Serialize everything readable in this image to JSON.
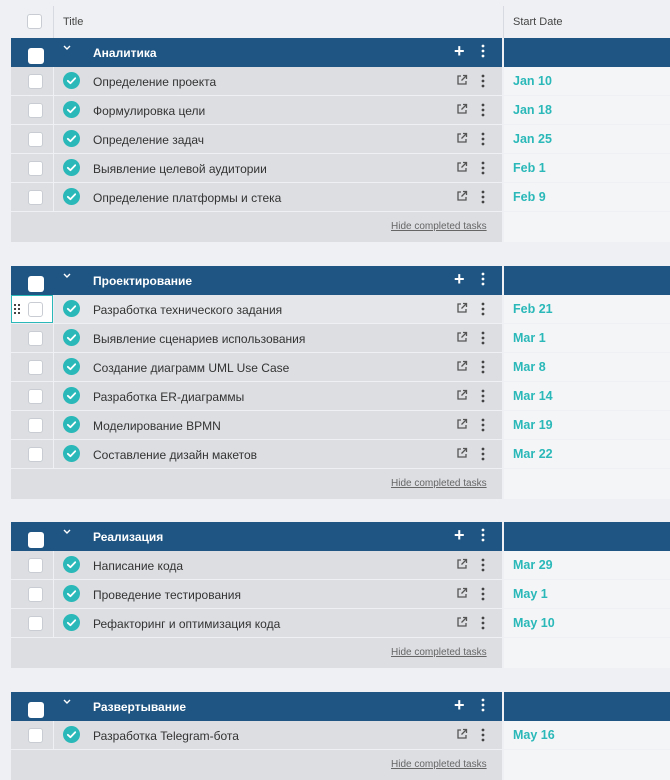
{
  "header": {
    "title_label": "Title",
    "date_label": "Start Date"
  },
  "colors": {
    "group_header": "#1f5582",
    "accent": "#2ab8b8",
    "row_bg": "#dcdee2"
  },
  "icons": {
    "group": [
      "chevron-down-icon",
      "plus-icon",
      "more-vertical-icon"
    ],
    "row": [
      "check-circle-icon",
      "external-link-icon",
      "more-vertical-icon"
    ]
  },
  "groups": [
    {
      "name": "Аналитика",
      "plus": "+",
      "footer_link": "Hide completed tasks",
      "tasks": [
        {
          "title": "Определение проекта",
          "date": "Jan 10"
        },
        {
          "title": "Формулировка цели",
          "date": "Jan 18"
        },
        {
          "title": "Определение задач",
          "date": "Jan 25"
        },
        {
          "title": "Выявление целевой аудитории",
          "date": "Feb 1"
        },
        {
          "title": "Определение платформы и стека",
          "date": "Feb 9"
        }
      ]
    },
    {
      "name": "Проектирование",
      "plus": "+",
      "footer_link": "Hide completed tasks",
      "tasks": [
        {
          "title": "Разработка технического задания",
          "date": "Feb 21"
        },
        {
          "title": "Выявление сценариев использования",
          "date": "Mar 1"
        },
        {
          "title": "Создание диаграмм UML Use Case",
          "date": "Mar 8"
        },
        {
          "title": "Разработка ER-диаграммы",
          "date": "Mar 14"
        },
        {
          "title": "Моделирование BPMN",
          "date": "Mar 19"
        },
        {
          "title": "Составление дизайн макетов",
          "date": "Mar 22"
        }
      ]
    },
    {
      "name": "Реализация",
      "plus": "+",
      "footer_link": "Hide completed tasks",
      "tasks": [
        {
          "title": "Написание кода",
          "date": "Mar 29"
        },
        {
          "title": "Проведение тестирования",
          "date": "May 1"
        },
        {
          "title": "Рефакторинг и оптимизация кода",
          "date": "May 10"
        }
      ]
    },
    {
      "name": "Развертывание",
      "plus": "+",
      "footer_link": "Hide completed tasks",
      "tasks": [
        {
          "title": "Разработка Telegram-бота",
          "date": "May 16"
        }
      ]
    }
  ]
}
